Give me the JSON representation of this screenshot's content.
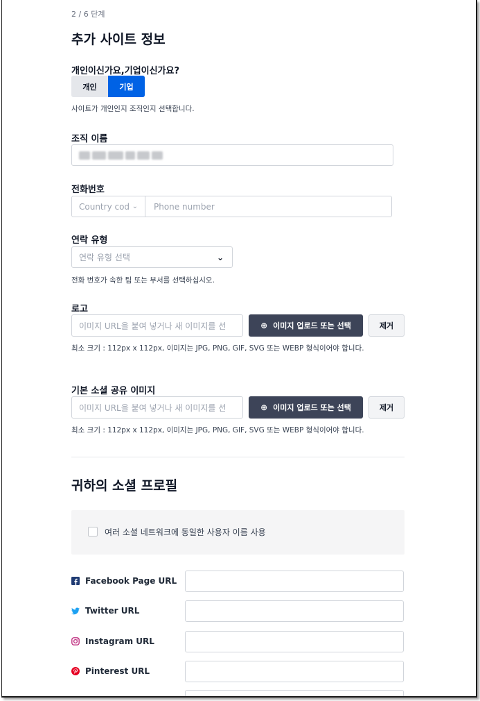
{
  "step": "2 / 6 단계",
  "title": "추가 사이트 정보",
  "site_type": {
    "label": "개인이신가요,기업이신가요?",
    "options": [
      "개인",
      "기업"
    ],
    "selected": "기업",
    "help": "사이트가 개인인지 조직인지 선택합니다."
  },
  "org_name": {
    "label": "조직 이름",
    "value": ""
  },
  "phone": {
    "label": "전화번호",
    "country_placeholder": "Country cod",
    "number_placeholder": "Phone number"
  },
  "contact_type": {
    "label": "연락 유형",
    "placeholder": "연락 유형 선택",
    "help": "전화 번호가 속한 팀 또는 부서를 선택하십시오."
  },
  "logo": {
    "label": "로고",
    "placeholder": "이미지 URL을 붙여 넣거나 새 이미지를 선",
    "upload_button": "이미지 업로드 또는 선택",
    "remove_button": "제거",
    "help": "최소 크기 : 112px x 112px, 이미지는 JPG, PNG, GIF, SVG 또는 WEBP 형식이어야 합니다."
  },
  "social_image": {
    "label": "기본 소셜 공유 이미지",
    "placeholder": "이미지 URL을 붙여 넣거나 새 이미지를 선",
    "upload_button": "이미지 업로드 또는 선택",
    "remove_button": "제거",
    "help": "최소 크기 : 112px x 112px, 이미지는 JPG, PNG, GIF, SVG 또는 WEBP 형식이어야 합니다."
  },
  "social_profile": {
    "title": "귀하의 소셜 프로필",
    "same_username_label": "여러 소셜 네트워크에 동일한 사용자 이름 사용",
    "same_username_checked": false,
    "fields": [
      {
        "name": "Facebook Page URL",
        "icon": "facebook-icon",
        "color": "#1877f2",
        "value": ""
      },
      {
        "name": "Twitter URL",
        "icon": "twitter-icon",
        "color": "#1da1f2",
        "value": ""
      },
      {
        "name": "Instagram URL",
        "icon": "instagram-icon",
        "color": "#c13584",
        "value": ""
      },
      {
        "name": "Pinterest URL",
        "icon": "pinterest-icon",
        "color": "#e60023",
        "value": ""
      }
    ]
  },
  "colors": {
    "accent": "#0062e5",
    "dark_button": "#3d4458"
  }
}
